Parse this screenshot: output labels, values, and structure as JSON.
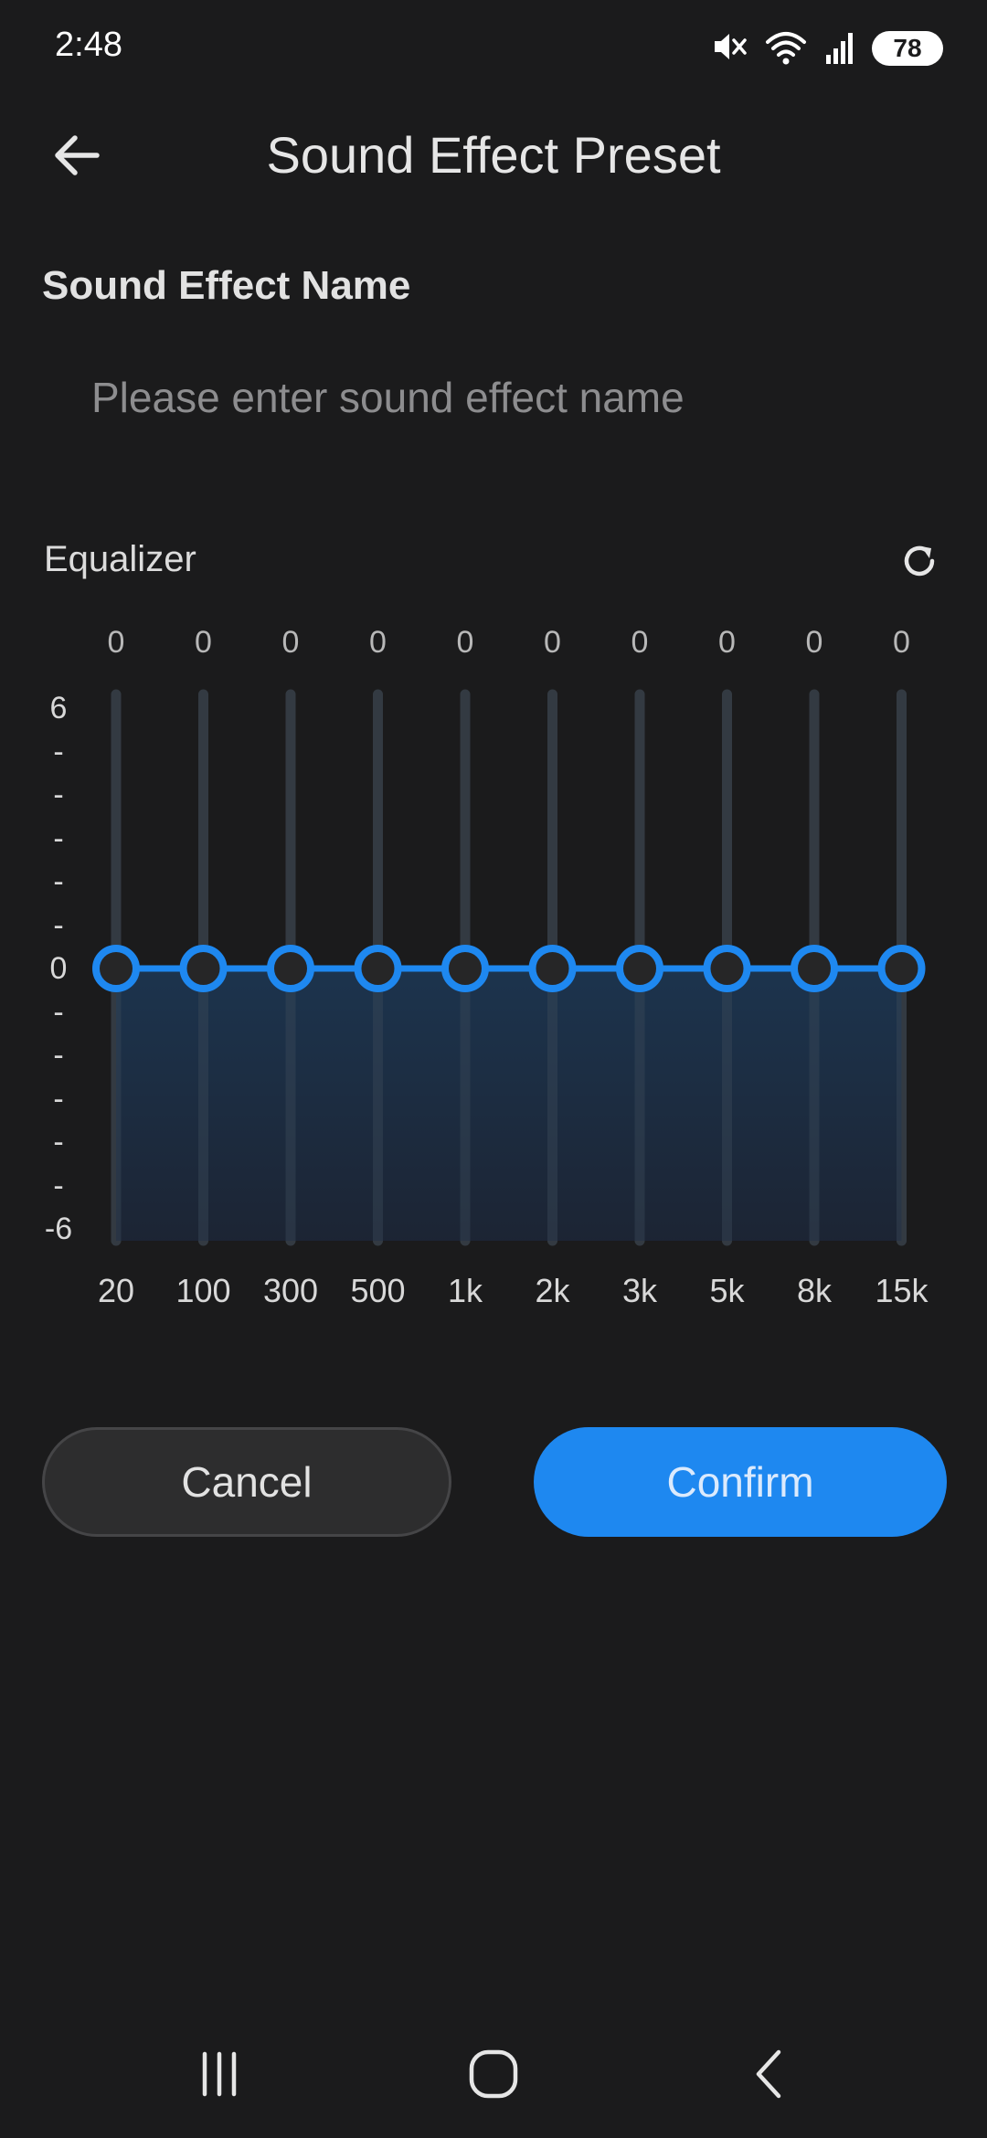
{
  "status_bar": {
    "time": "2:48",
    "icons": [
      "mute-icon",
      "wifi-icon",
      "signal-icon"
    ],
    "battery_level": "78"
  },
  "header": {
    "title": "Sound Effect Preset",
    "back_icon": "arrow-left-icon"
  },
  "name_section": {
    "label": "Sound Effect Name",
    "input_value": "",
    "placeholder": "Please enter sound effect name"
  },
  "equalizer": {
    "label": "Equalizer",
    "reset_icon": "refresh-icon",
    "bands": [
      {
        "frequency": "20",
        "value": 0,
        "value_label": "0"
      },
      {
        "frequency": "100",
        "value": 0,
        "value_label": "0"
      },
      {
        "frequency": "300",
        "value": 0,
        "value_label": "0"
      },
      {
        "frequency": "500",
        "value": 0,
        "value_label": "0"
      },
      {
        "frequency": "1k",
        "value": 0,
        "value_label": "0"
      },
      {
        "frequency": "2k",
        "value": 0,
        "value_label": "0"
      },
      {
        "frequency": "3k",
        "value": 0,
        "value_label": "0"
      },
      {
        "frequency": "5k",
        "value": 0,
        "value_label": "0"
      },
      {
        "frequency": "8k",
        "value": 0,
        "value_label": "0"
      },
      {
        "frequency": "15k",
        "value": 0,
        "value_label": "0"
      }
    ],
    "y_ticks": [
      "6",
      "-",
      "-",
      "-",
      "-",
      "-",
      "0",
      "-",
      "-",
      "-",
      "-",
      "-",
      "-6"
    ],
    "range": [
      -6,
      6
    ],
    "accent_color": "#1e88f0"
  },
  "actions": {
    "cancel_label": "Cancel",
    "confirm_label": "Confirm"
  },
  "nav_bar": {
    "icons": [
      "recent-apps-icon",
      "home-icon",
      "back-icon"
    ]
  }
}
